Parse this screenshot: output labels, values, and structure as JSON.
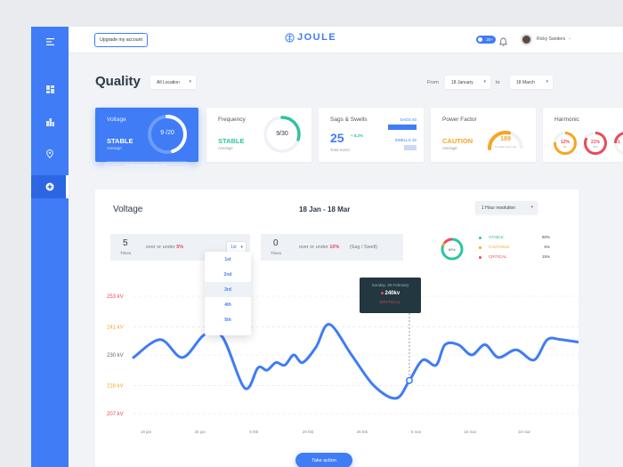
{
  "topbar": {
    "upgrade_label": "Upgrade my account",
    "brand": "JOULE",
    "toggle_label": "20+",
    "user_name": "Ricky Sanders"
  },
  "filters": {
    "title": "Quality",
    "location": "All Location",
    "from_label": "From",
    "from_value": "18 January",
    "to_label": "to",
    "to_value": "18 March"
  },
  "cards": {
    "voltage": {
      "title": "Voltage",
      "status": "STABLE",
      "sub": "Average",
      "ring_text": "9 /20",
      "ring_value": 9,
      "ring_max": 20,
      "note": "5 min intervals under -5%"
    },
    "frequency": {
      "title": "Frequency",
      "status": "STABLE",
      "sub": "Average",
      "ring_text": "9/30",
      "ring_value": 9,
      "ring_max": 30
    },
    "sags": {
      "title": "Sags & Swells",
      "value": "25",
      "delta": "+ 8.2%",
      "sub": "Total event",
      "sags_label": "SAGS 40",
      "swells_label": "SWELLS 32"
    },
    "pf": {
      "title": "Power Factor",
      "status": "CAUTION",
      "sub": "Average",
      "ring_text": "189",
      "ring_sub": "No data Loss (ms)"
    },
    "harmonic": {
      "title": "Harmonic",
      "r1": "12%",
      "r1_sub": "#1",
      "r2": "21%",
      "r2_sub": "#32",
      "r3": "1"
    }
  },
  "panel": {
    "title": "Voltage",
    "range": "18 Jan - 18 Mar",
    "resolution": "1 Hour resolution",
    "box1_value": "5",
    "box1_unit": "Times",
    "box1_text": "over or under",
    "box1_pct": "5%",
    "box1_select": "1st",
    "box2_value": "0",
    "box2_unit": "Times",
    "box2_text": "over or under",
    "box2_pct": "10%",
    "box2_tail": "(Sag / Swell)",
    "donut_label": "80%",
    "legend": [
      {
        "name": "STABLE",
        "value": "80%",
        "color": "#2ec4a0"
      },
      {
        "name": "CAUTIOUS",
        "value": "5%",
        "color": "#f5a623"
      },
      {
        "name": "CRITICAL",
        "value": "15%",
        "color": "#e94b5a"
      }
    ],
    "dropdown": [
      "1st",
      "2nd",
      "3rd",
      "4th",
      "5th"
    ],
    "tooltip": {
      "date": "Sunday, 28 February",
      "value": "240kv",
      "status": "CRITICAL"
    },
    "action_label": "Take action"
  },
  "chart_data": {
    "type": "line",
    "y_ticks": [
      {
        "label": "253 kV",
        "value": 253,
        "color": "#e94b5a"
      },
      {
        "label": "241 kV",
        "value": 241,
        "color": "#f5a623"
      },
      {
        "label": "230 kV",
        "value": 230,
        "color": "#666666"
      },
      {
        "label": "218 kV",
        "value": 218,
        "color": "#f5a623"
      },
      {
        "label": "207 kV",
        "value": 207,
        "color": "#e94b5a"
      }
    ],
    "x_labels": [
      "19 jan",
      "25 jan",
      "5 feb",
      "20 feb",
      "25 feb",
      "5 mar",
      "10 mar",
      "18 mar"
    ],
    "ylim": [
      207,
      253
    ],
    "x": [
      0,
      0.06,
      0.11,
      0.16,
      0.2,
      0.25,
      0.28,
      0.3,
      0.32,
      0.34,
      0.36,
      0.38,
      0.41,
      0.44,
      0.49,
      0.54,
      0.59,
      0.62,
      0.65,
      0.68,
      0.7,
      0.73,
      0.76,
      0.79,
      0.82,
      0.86,
      0.9,
      0.93,
      0.96,
      1
    ],
    "y": [
      229,
      236,
      229,
      238,
      237,
      217,
      225,
      224,
      227,
      226,
      230,
      227,
      233,
      242,
      230,
      218,
      213,
      220,
      228,
      226,
      234,
      234,
      230,
      234,
      229,
      232,
      228,
      236,
      236,
      235
    ],
    "highlight": {
      "x": 0.62,
      "label": "240kv"
    }
  },
  "colors": {
    "accent": "#3f7cf6",
    "stable": "#2ec4a0",
    "caution": "#f5a623",
    "critical": "#e94b5a"
  },
  "sidebar": {
    "icons": [
      "menu-icon",
      "dashboard-icon",
      "building-icon",
      "location-icon",
      "quality-icon"
    ]
  }
}
